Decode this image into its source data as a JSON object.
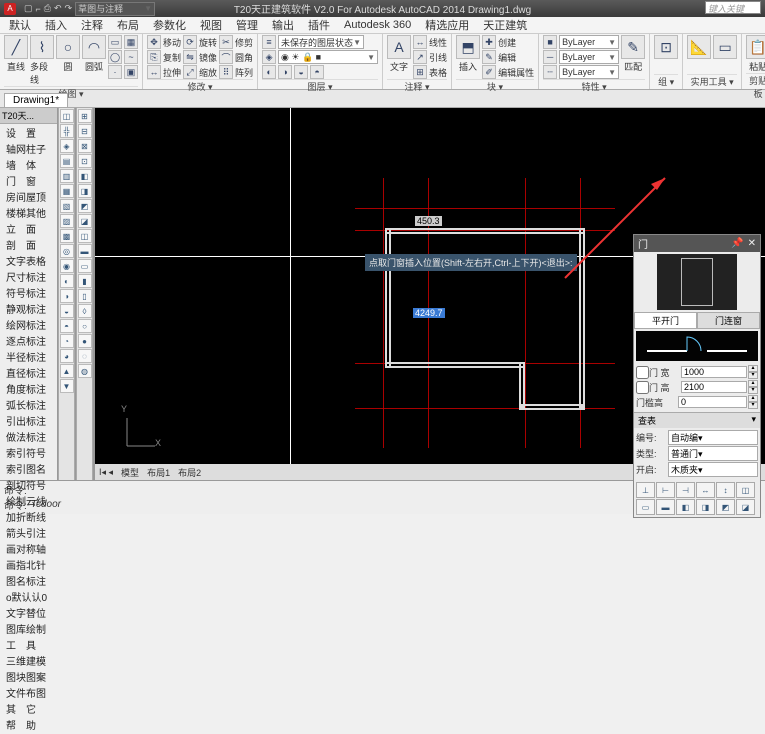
{
  "title": "T20天正建筑软件 V2.0 For Autodesk AutoCAD 2014   Drawing1.dwg",
  "search_placeholder": "键入关键",
  "qat_combo": "草图与注释",
  "menu": [
    "默认",
    "插入",
    "注释",
    "布局",
    "参数化",
    "视图",
    "管理",
    "输出",
    "插件",
    "Autodesk 360",
    "精选应用",
    "天正建筑"
  ],
  "ribbon": {
    "draw": {
      "label": "绘图 ▾",
      "b1": "直线",
      "b2": "多段线",
      "b3": "圆",
      "b4": "圆弧"
    },
    "modify": {
      "label": "修改 ▾",
      "items": [
        "移动",
        "旋转",
        "修剪",
        "复制",
        "镜像",
        "圆角",
        "拉伸",
        "缩放",
        "阵列"
      ]
    },
    "layer": {
      "label": "图层 ▾",
      "combo": "未保存的图层状态"
    },
    "annot": {
      "label": "注释 ▾",
      "btn": "文字",
      "items": [
        "线性",
        "引线",
        "表格"
      ]
    },
    "block": {
      "label": "块 ▾",
      "btn": "插入",
      "items": [
        "创建",
        "编辑",
        "编辑属性"
      ]
    },
    "prop": {
      "label": "特性 ▾",
      "layer": "ByLayer",
      "match": "匹配"
    },
    "group": {
      "label": "组 ▾"
    },
    "util": {
      "label": "实用工具 ▾"
    },
    "clip": {
      "label": "剪贴板",
      "btn": "粘贴"
    }
  },
  "doc_tab": "Drawing1*",
  "palette_title": "T20天...",
  "palette_items": [
    "设　置",
    "轴网柱子",
    "墙　体",
    "门　窗",
    "房间屋顶",
    "楼梯其他",
    "立　面",
    "剖　面",
    "文字表格",
    "尺寸标注",
    "符号标注",
    "静观标注",
    "绘网标注",
    "逐点标注",
    "半径标注",
    "直径标注",
    "角度标注",
    "弧长标注",
    "引出标注",
    "做法标注",
    "索引符号",
    "索引图名",
    "剖切符号",
    "绘制云线",
    "加折断线",
    "箭头引注",
    "画对称轴",
    "画指北针",
    "图名标注",
    "o默认认0",
    "文字替位",
    "图库绘制",
    "工　具",
    "三维建模",
    "图块图案",
    "文件布图",
    "其　它",
    "帮　助"
  ],
  "dim1": "450.3",
  "dim2": "4249.7",
  "tooltip": "点取门窗插入位置(Shift-左右开,Ctrl-上下开)<退出>:",
  "ucs": {
    "x": "X",
    "y": "Y"
  },
  "modeltabs": [
    "模型",
    "布局1",
    "布局2"
  ],
  "cmd": {
    "l1": "命令:",
    "l2": "命令:",
    "val": "Tcdoor"
  },
  "door": {
    "title": "门",
    "tabs": [
      "平开门",
      "门连窗"
    ],
    "fields": [
      {
        "label": "门 宽",
        "val": "1000"
      },
      {
        "label": "门 高",
        "val": "2100"
      },
      {
        "label": "门槛高",
        "val": "0"
      }
    ],
    "section": "查表",
    "section2a": "编号:",
    "section2b": "自动编▾",
    "section3a": "类型:",
    "section3b": "普通门▾",
    "section4a": "开启:",
    "section4b": "木质夹▾"
  }
}
